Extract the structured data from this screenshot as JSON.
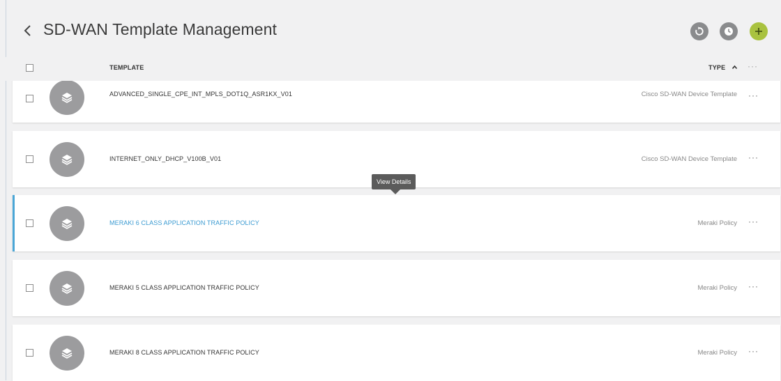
{
  "header": {
    "title": "SD-WAN Template Management",
    "refresh_icon": "refresh-icon",
    "history_icon": "clock-icon",
    "add_icon": "plus-icon",
    "accent_color": "#a9c23f"
  },
  "table": {
    "col_template": "TEMPLATE",
    "col_type": "TYPE",
    "col_more": "···",
    "rows": [
      {
        "name": "ADVANCED_SINGLE_CPE_INT_MPLS_DOT1Q_ASR1KX_V01",
        "type": "Cisco SD-WAN Device Template",
        "more": "···"
      },
      {
        "name": "INTERNET_ONLY_DHCP_V100B_V01",
        "type": "Cisco SD-WAN Device Template",
        "more": "···"
      },
      {
        "name": "MERAKI 6 CLASS APPLICATION TRAFFIC POLICY",
        "type": "Meraki Policy",
        "more": "···"
      },
      {
        "name": "MERAKI 5 CLASS APPLICATION TRAFFIC POLICY",
        "type": "Meraki Policy",
        "more": "···"
      },
      {
        "name": "MERAKI 8 CLASS APPLICATION TRAFFIC POLICY",
        "type": "Meraki Policy",
        "more": "···"
      }
    ]
  },
  "tooltip": {
    "text": "View Details"
  },
  "colors": {
    "active_link": "#3a9ad1",
    "active_border": "#4aa6d6"
  }
}
